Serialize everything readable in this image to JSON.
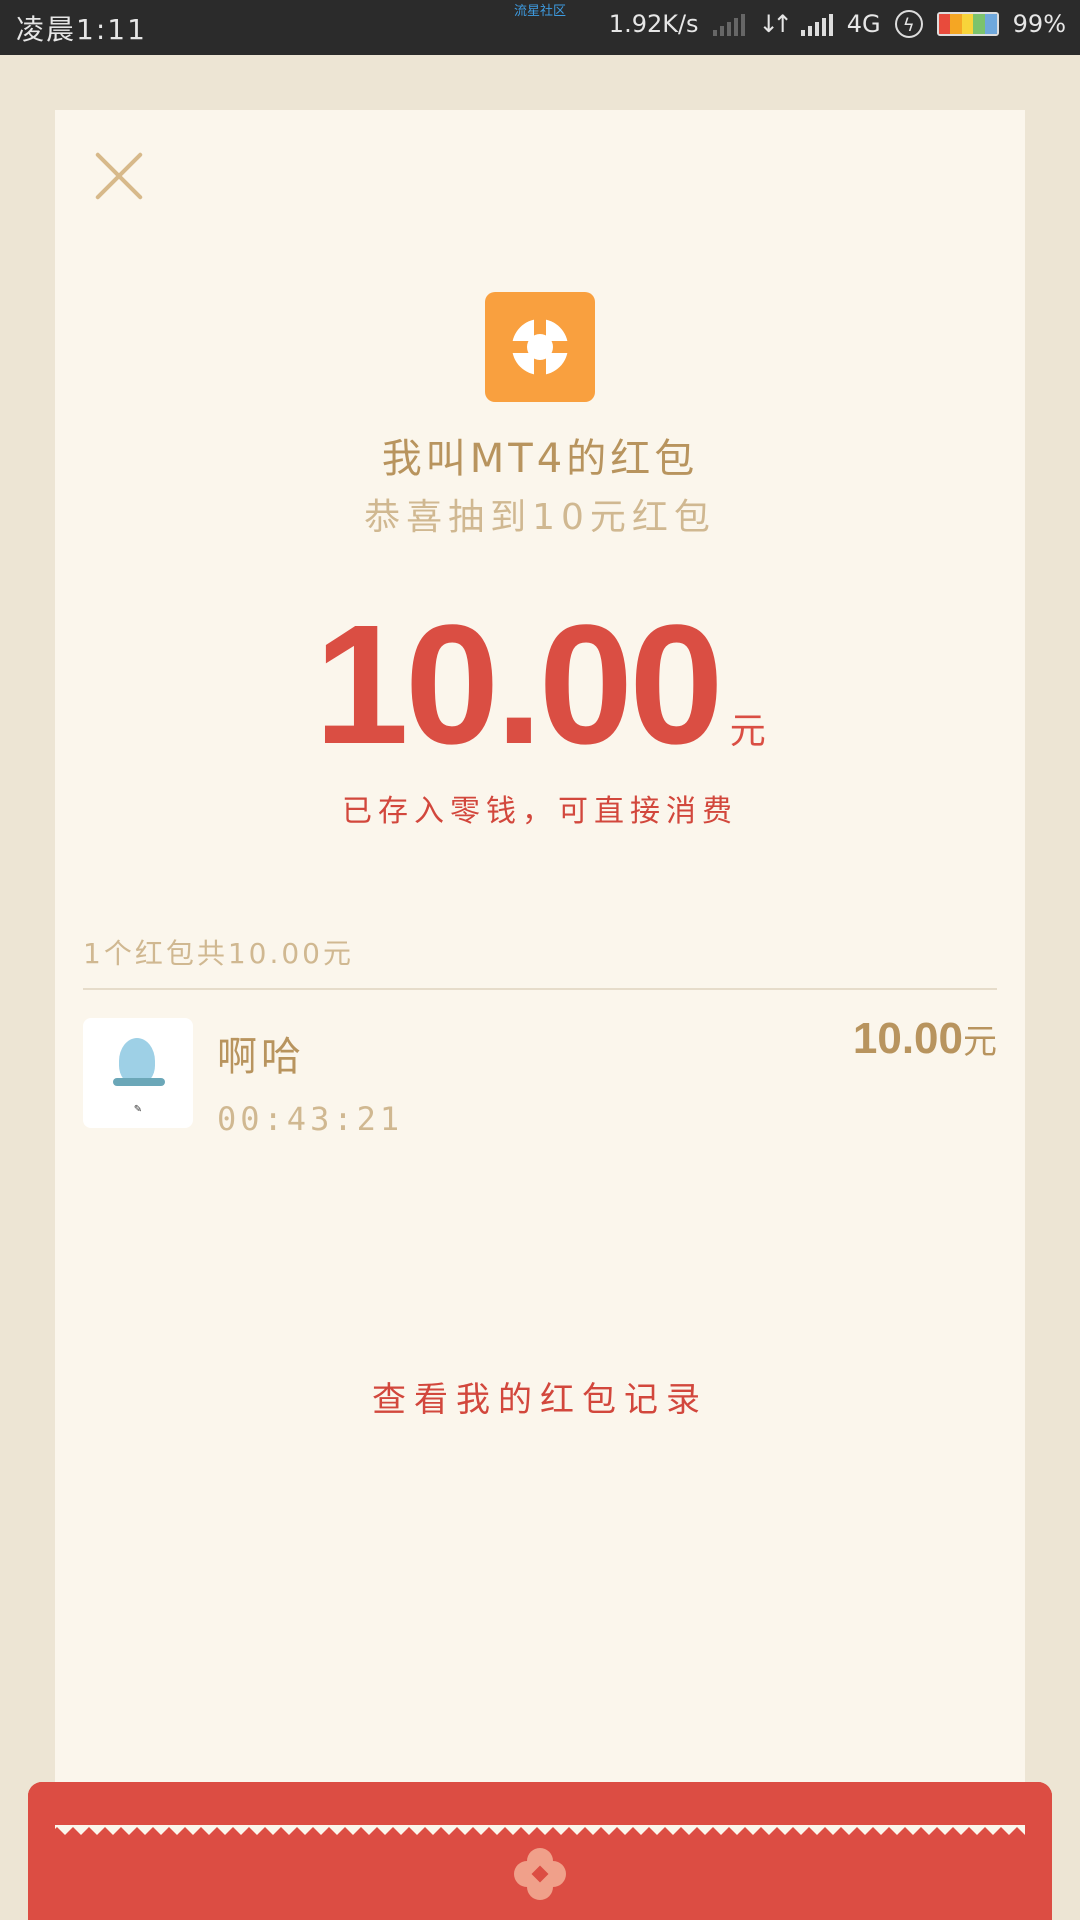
{
  "status_bar": {
    "time": "凌晨1:11",
    "community": "流星社区",
    "speed": "1.92K/s",
    "network": "4G",
    "battery": "99%"
  },
  "red_packet": {
    "sender_title": "我叫MT4的红包",
    "greeting": "恭喜抽到10元红包",
    "amount": "10.00",
    "amount_unit": "元",
    "stored_note": "已存入零钱，可直接消费",
    "summary": "1个红包共10.00元",
    "records": [
      {
        "name": "啊哈",
        "time": "00:43:21",
        "amount": "10.00",
        "unit": "元"
      }
    ],
    "record_link": "查看我的红包记录"
  },
  "colors": {
    "background": "#EDE5D4",
    "card": "#FBF6EC",
    "gold": "#B8945E",
    "red": "#DA4E43",
    "logo_orange": "#F9A03F"
  },
  "icons": {
    "close": "close-icon",
    "logo": "mt4-logo-icon",
    "flower": "flower-icon"
  }
}
